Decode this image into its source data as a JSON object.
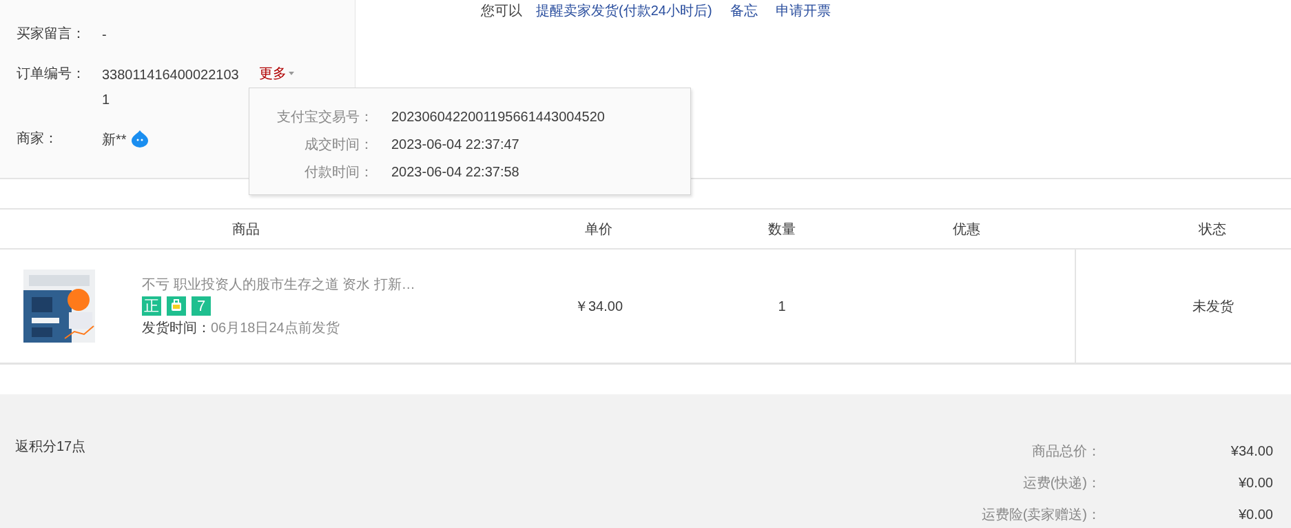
{
  "order_info": [
    {
      "label": "买家留言：",
      "value": "-"
    },
    {
      "label": "订单编号：",
      "value": "3380114164000221031",
      "more": "更多"
    },
    {
      "label": "商家：",
      "value": "新**",
      "chat": true
    }
  ],
  "actions": {
    "prompt": "您可以",
    "links": [
      "提醒卖家发货(付款24小时后)",
      "备忘",
      "申请开票"
    ]
  },
  "popover": {
    "rows": [
      {
        "label": "支付宝交易号：",
        "value": "2023060422001195661443004520"
      },
      {
        "label": "成交时间：",
        "value": "2023-06-04 22:37:47"
      },
      {
        "label": "付款时间：",
        "value": "2023-06-04 22:37:58"
      }
    ]
  },
  "table": {
    "columns": [
      "商品",
      "单价",
      "数量",
      "优惠",
      "状态"
    ],
    "rows": [
      {
        "title": "不亏 职业投资人的股市生存之道 资水 打新…",
        "badges": [
          {
            "kind": "text",
            "text": "正"
          },
          {
            "kind": "icon"
          },
          {
            "kind": "text",
            "text": "7"
          }
        ],
        "ship_label": "发货时间：",
        "ship_value": "06月18日24点前发货",
        "price": "￥34.00",
        "quantity": "1",
        "status": "未发货"
      }
    ]
  },
  "footer": {
    "points": "返积分17点",
    "summary": [
      {
        "label": "商品总价：",
        "value": "¥34.00"
      },
      {
        "label": "运费(快递)：",
        "value": "¥0.00"
      },
      {
        "label": "运费险(卖家赠送)：",
        "value": "¥0.00"
      }
    ]
  }
}
